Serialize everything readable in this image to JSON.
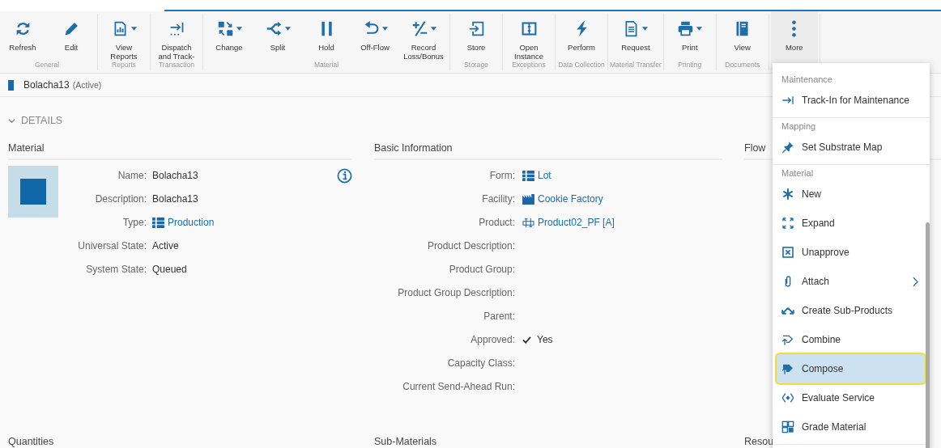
{
  "toolbar": {
    "groups": [
      {
        "label": "General",
        "buttons": [
          {
            "label": "Refresh",
            "has_menu": false
          },
          {
            "label": "Edit",
            "has_menu": false
          }
        ]
      },
      {
        "label": "Reports",
        "buttons": [
          {
            "label": "View Reports",
            "has_menu": true
          }
        ]
      },
      {
        "label": "Transaction",
        "buttons": [
          {
            "label": "Dispatch and Track-",
            "has_menu": false
          }
        ]
      },
      {
        "label": "Material",
        "buttons": [
          {
            "label": "Change",
            "has_menu": true
          },
          {
            "label": "Split",
            "has_menu": true
          },
          {
            "label": "Hold",
            "has_menu": false
          },
          {
            "label": "Off-Flow",
            "has_menu": true
          },
          {
            "label": "Record Loss/Bonus",
            "has_menu": true
          }
        ]
      },
      {
        "label": "Storage",
        "buttons": [
          {
            "label": "Store",
            "has_menu": false
          }
        ]
      },
      {
        "label": "Exceptions",
        "buttons": [
          {
            "label": "Open Instance",
            "has_menu": false
          }
        ]
      },
      {
        "label": "Data Collection",
        "buttons": [
          {
            "label": "Perform",
            "has_menu": false
          }
        ]
      },
      {
        "label": "Material Transfer",
        "buttons": [
          {
            "label": "Request",
            "has_menu": true
          }
        ]
      },
      {
        "label": "Printing",
        "buttons": [
          {
            "label": "Print",
            "has_menu": true
          }
        ]
      },
      {
        "label": "Documents",
        "buttons": [
          {
            "label": "View",
            "has_menu": false
          }
        ]
      }
    ],
    "more_button": {
      "label": "More",
      "selected": true
    }
  },
  "header": {
    "title": "Bolacha13",
    "status": "(Active)"
  },
  "details": {
    "label": "DETAILS",
    "expanded": true
  },
  "material": {
    "title": "Material",
    "fields": [
      {
        "label": "Name:",
        "value": "Bolacha13",
        "kind": "text"
      },
      {
        "label": "Description:",
        "value": "Bolacha13",
        "kind": "text"
      },
      {
        "label": "Type:",
        "value": "Production",
        "kind": "link"
      },
      {
        "label": "Universal State:",
        "value": "Active",
        "kind": "text"
      },
      {
        "label": "System State:",
        "value": "Queued",
        "kind": "text"
      }
    ]
  },
  "basic_information": {
    "title": "Basic Information",
    "fields": [
      {
        "label": "Form:",
        "value": "Lot",
        "kind": "link"
      },
      {
        "label": "Facility:",
        "value": "Cookie Factory",
        "kind": "link"
      },
      {
        "label": "Product:",
        "value": "Product02_PF [A]",
        "kind": "link"
      },
      {
        "label": "Product Description:"
      },
      {
        "label": "Product Group:"
      },
      {
        "label": "Product Group Description:"
      },
      {
        "label": "Parent:"
      },
      {
        "label": "Approved:",
        "value": "Yes",
        "kind": "check"
      },
      {
        "label": "Capacity Class:"
      },
      {
        "label": "Current Send-Ahead Run:"
      }
    ]
  },
  "flow": {
    "title": "Flow"
  },
  "bottom_sections": [
    {
      "title": "Quantities"
    },
    {
      "title": "Sub-Materials"
    },
    {
      "title": "Resou"
    }
  ],
  "more_menu": {
    "sections": [
      {
        "label": "Maintenance",
        "items": [
          {
            "label": "Track-In for Maintenance",
            "selected": false,
            "has_submenu": false
          }
        ]
      },
      {
        "label": "Mapping",
        "items": [
          {
            "label": "Set Substrate Map",
            "selected": false,
            "has_submenu": false
          }
        ]
      },
      {
        "label": "Material",
        "items": [
          {
            "label": "New",
            "selected": false,
            "has_submenu": false
          },
          {
            "label": "Expand",
            "selected": false,
            "has_submenu": false
          },
          {
            "label": "Unapprove",
            "selected": false,
            "has_submenu": false
          },
          {
            "label": "Attach",
            "selected": false,
            "has_submenu": true
          },
          {
            "label": "Create Sub-Products",
            "selected": false,
            "has_submenu": false
          },
          {
            "label": "Combine",
            "selected": false,
            "has_submenu": false
          },
          {
            "label": "Compose",
            "selected": true,
            "has_submenu": false
          },
          {
            "label": "Evaluate Service",
            "selected": false,
            "has_submenu": false
          },
          {
            "label": "Grade Material",
            "selected": false,
            "has_submenu": false
          }
        ]
      }
    ]
  }
}
